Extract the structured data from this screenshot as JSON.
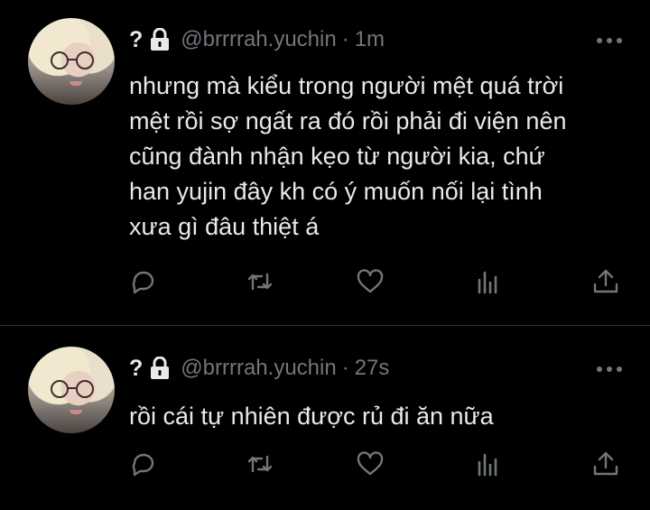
{
  "tweets": [
    {
      "display_name": "?",
      "handle": "@brrrrah.yuchin",
      "separator": "·",
      "time": "1m",
      "text": "nhưng mà kiểu trong người mệt quá trời\nmệt rồi sợ ngất ra đó rồi phải đi viện nên\ncũng đành nhận kẹo từ người kia, chứ\nhan yujin đây kh có ý muốn nối lại tình\nxưa gì đâu thiệt á"
    },
    {
      "display_name": "?",
      "handle": "@brrrrah.yuchin",
      "separator": "·",
      "time": "27s",
      "text": "rồi cái tự nhiên được rủ đi ăn nữa"
    }
  ],
  "icons": {
    "lock": "lock-icon",
    "more": "more-horizontal-icon",
    "reply": "reply-icon",
    "retweet": "retweet-icon",
    "like": "heart-icon",
    "views": "views-icon",
    "share": "share-icon"
  },
  "colors": {
    "background": "#000000",
    "text": "#e7e9ea",
    "muted": "#71767b",
    "divider": "#2f3336"
  }
}
